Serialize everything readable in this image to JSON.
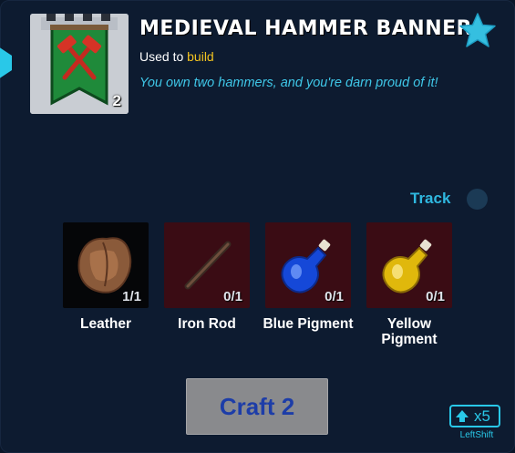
{
  "item": {
    "title": "MEDIEVAL HAMMER BANNER",
    "used_to_prefix": "Used to",
    "used_to_keyword": "build",
    "flavor": "You own two hammers, and you're darn proud of it!",
    "owned_count": "2",
    "icon": "medieval-hammer-banner-icon"
  },
  "favorite": {
    "icon": "star-icon"
  },
  "track": {
    "label": "Track",
    "enabled": false
  },
  "ingredients": [
    {
      "name": "Leather",
      "count": "1/1",
      "icon": "leather-icon",
      "have": true
    },
    {
      "name": "Iron Rod",
      "count": "0/1",
      "icon": "iron-rod-icon",
      "have": false
    },
    {
      "name": "Blue Pigment",
      "count": "0/1",
      "icon": "blue-pigment-icon",
      "have": false
    },
    {
      "name": "Yellow Pigment",
      "count": "0/1",
      "icon": "yellow-pigment-icon",
      "have": false
    }
  ],
  "craft": {
    "label": "Craft 2"
  },
  "multiplier": {
    "label": "x5",
    "key": "LeftShift",
    "icon": "shift-arrow-icon"
  },
  "colors": {
    "background": "#0d1b30",
    "accent": "#29c8e8",
    "keyword": "#f2c320",
    "missing_slot": "#3a0c14",
    "owned_slot": "#050608",
    "craft_text": "#1d3da8"
  }
}
